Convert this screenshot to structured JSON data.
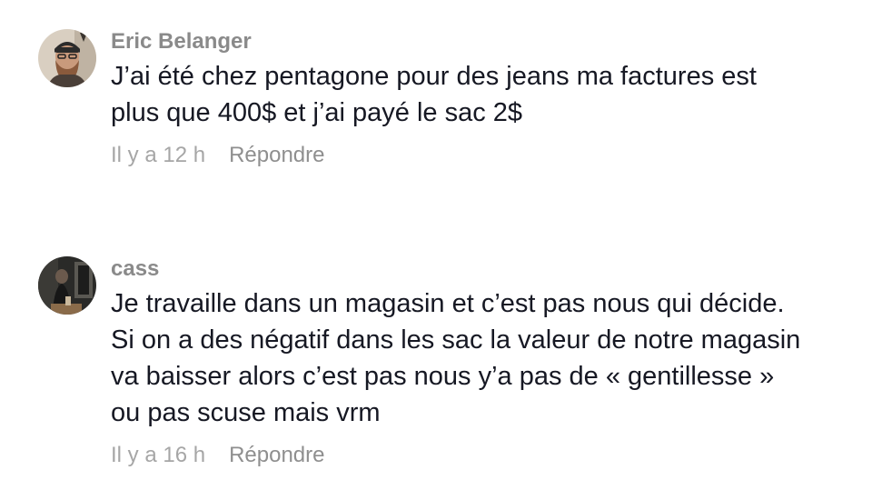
{
  "comments": [
    {
      "username": "Eric Belanger",
      "avatar_icon": "bearded-man-avatar",
      "text_lines": [
        "J’ai été chez pentagone pour des jeans ma factures est",
        "plus que 400$ et j’ai payé le sac 2$"
      ],
      "time": "Il y a 12 h",
      "reply_label": "Répondre"
    },
    {
      "username": "cass",
      "avatar_icon": "dark-room-avatar",
      "text_lines": [
        "Je travaille dans un magasin et c’est pas nous qui décide.",
        "Si on a des négatif dans les sac la valeur de notre magasin",
        "va baisser alors c’est pas nous y’a pas de « gentillesse »",
        "ou pas scuse mais vrm"
      ],
      "time": "Il y a 16 h",
      "reply_label": "Répondre"
    }
  ],
  "colors": {
    "username": "#8a8a8a",
    "text": "#161823",
    "meta": "#a6a6a6",
    "background": "#ffffff"
  }
}
